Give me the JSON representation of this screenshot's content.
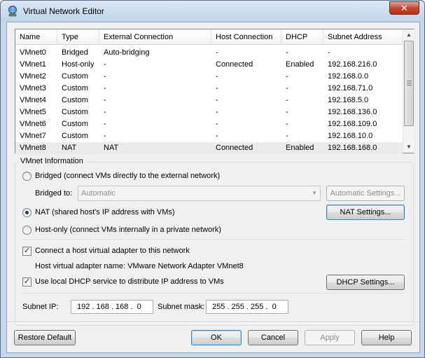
{
  "window": {
    "title": "Virtual Network Editor",
    "close_label": "✕"
  },
  "table": {
    "headers": [
      "Name",
      "Type",
      "External Connection",
      "Host Connection",
      "DHCP",
      "Subnet Address"
    ],
    "rows": [
      [
        "VMnet0",
        "Bridged",
        "Auto-bridging",
        "-",
        "-",
        "-"
      ],
      [
        "VMnet1",
        "Host-only",
        "-",
        "Connected",
        "Enabled",
        "192.168.216.0"
      ],
      [
        "VMnet2",
        "Custom",
        "-",
        "-",
        "-",
        "192.168.0.0"
      ],
      [
        "VMnet3",
        "Custom",
        "-",
        "-",
        "-",
        "192.168.71.0"
      ],
      [
        "VMnet4",
        "Custom",
        "-",
        "-",
        "-",
        "192.168.5.0"
      ],
      [
        "VMnet5",
        "Custom",
        "-",
        "-",
        "-",
        "192.168.136.0"
      ],
      [
        "VMnet6",
        "Custom",
        "-",
        "-",
        "-",
        "192.168.109.0"
      ],
      [
        "VMnet7",
        "Custom",
        "-",
        "-",
        "-",
        "192.168.10.0"
      ],
      [
        "VMnet8",
        "NAT",
        "NAT",
        "Connected",
        "Enabled",
        "192.168.168.0"
      ]
    ],
    "selected_row": "VMnet8"
  },
  "vmnet_info": {
    "group_label": "VMnet Information",
    "bridged_label": "Bridged (connect VMs directly to the external network)",
    "bridged_to_label": "Bridged to:",
    "bridged_to_value": "Automatic",
    "auto_settings_button": "Automatic Settings...",
    "nat_label": "NAT (shared host's IP address with VMs)",
    "nat_settings_button": "NAT Settings...",
    "hostonly_label": "Host-only (connect VMs internally in a private network)",
    "selected_mode": "NAT",
    "connect_adapter_label": "Connect a host virtual adapter to this network",
    "connect_adapter_checked": true,
    "adapter_name_label": "Host virtual adapter name: VMware Network Adapter VMnet8",
    "dhcp_label": "Use local DHCP service to distribute IP address to VMs",
    "dhcp_checked": true,
    "dhcp_settings_button": "DHCP Settings...",
    "subnet_ip_label": "Subnet IP:",
    "subnet_ip_value": "192 . 168 . 168 .  0",
    "subnet_mask_label": "Subnet mask:",
    "subnet_mask_value": "255 . 255 . 255 .  0"
  },
  "footer": {
    "restore_default": "Restore Default",
    "ok": "OK",
    "cancel": "Cancel",
    "apply": "Apply",
    "help": "Help"
  },
  "icons": {
    "app_icon": "network-globe-icon",
    "checkmark": "✓"
  },
  "colors": {
    "title_bar": "#bfd3ea",
    "close_button": "#c9452c",
    "selected_row": "#ebebeb",
    "radio_dot": "#1a3e6d",
    "focus_border": "#3c7fb1"
  }
}
